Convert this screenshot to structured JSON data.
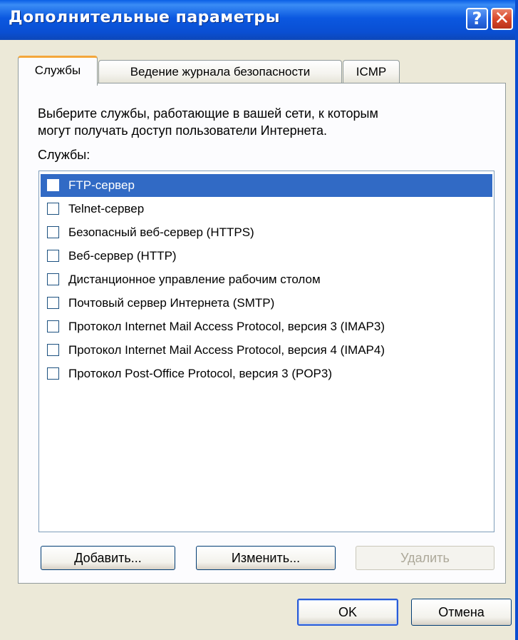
{
  "window": {
    "title": "Дополнительные параметры",
    "help_label": "?",
    "close_label": "✕"
  },
  "tabs": [
    {
      "label": "Службы",
      "active": true
    },
    {
      "label": "Ведение журнала безопасности",
      "active": false
    },
    {
      "label": "ICMP",
      "active": false
    }
  ],
  "panel": {
    "description_line1": "Выберите службы, работающие в вашей сети, к которым",
    "description_line2": "могут получать доступ пользователи Интернета.",
    "services_label": "Службы:",
    "services": [
      {
        "label": "FTP-сервер",
        "checked": false,
        "selected": true
      },
      {
        "label": "Telnet-сервер",
        "checked": false,
        "selected": false
      },
      {
        "label": "Безопасный веб-сервер (HTTPS)",
        "checked": false,
        "selected": false
      },
      {
        "label": "Веб-сервер (HTTP)",
        "checked": false,
        "selected": false
      },
      {
        "label": "Дистанционное управление рабочим столом",
        "checked": false,
        "selected": false
      },
      {
        "label": "Почтовый сервер Интернета (SMTP)",
        "checked": false,
        "selected": false
      },
      {
        "label": "Протокол Internet Mail Access Protocol, версия 3 (IMAP3)",
        "checked": false,
        "selected": false
      },
      {
        "label": "Протокол Internet Mail Access Protocol, версия 4 (IMAP4)",
        "checked": false,
        "selected": false
      },
      {
        "label": "Протокол Post-Office Protocol, версия 3 (POP3)",
        "checked": false,
        "selected": false
      }
    ],
    "add_button": "Добавить...",
    "edit_button": "Изменить...",
    "delete_button": "Удалить"
  },
  "footer": {
    "ok_button": "OK",
    "cancel_button": "Отмена"
  },
  "colors": {
    "titlebar": "#0a4fd3",
    "selection": "#316ac5",
    "active_tab_accent": "#f4a73b",
    "close_button": "#d9482a"
  }
}
